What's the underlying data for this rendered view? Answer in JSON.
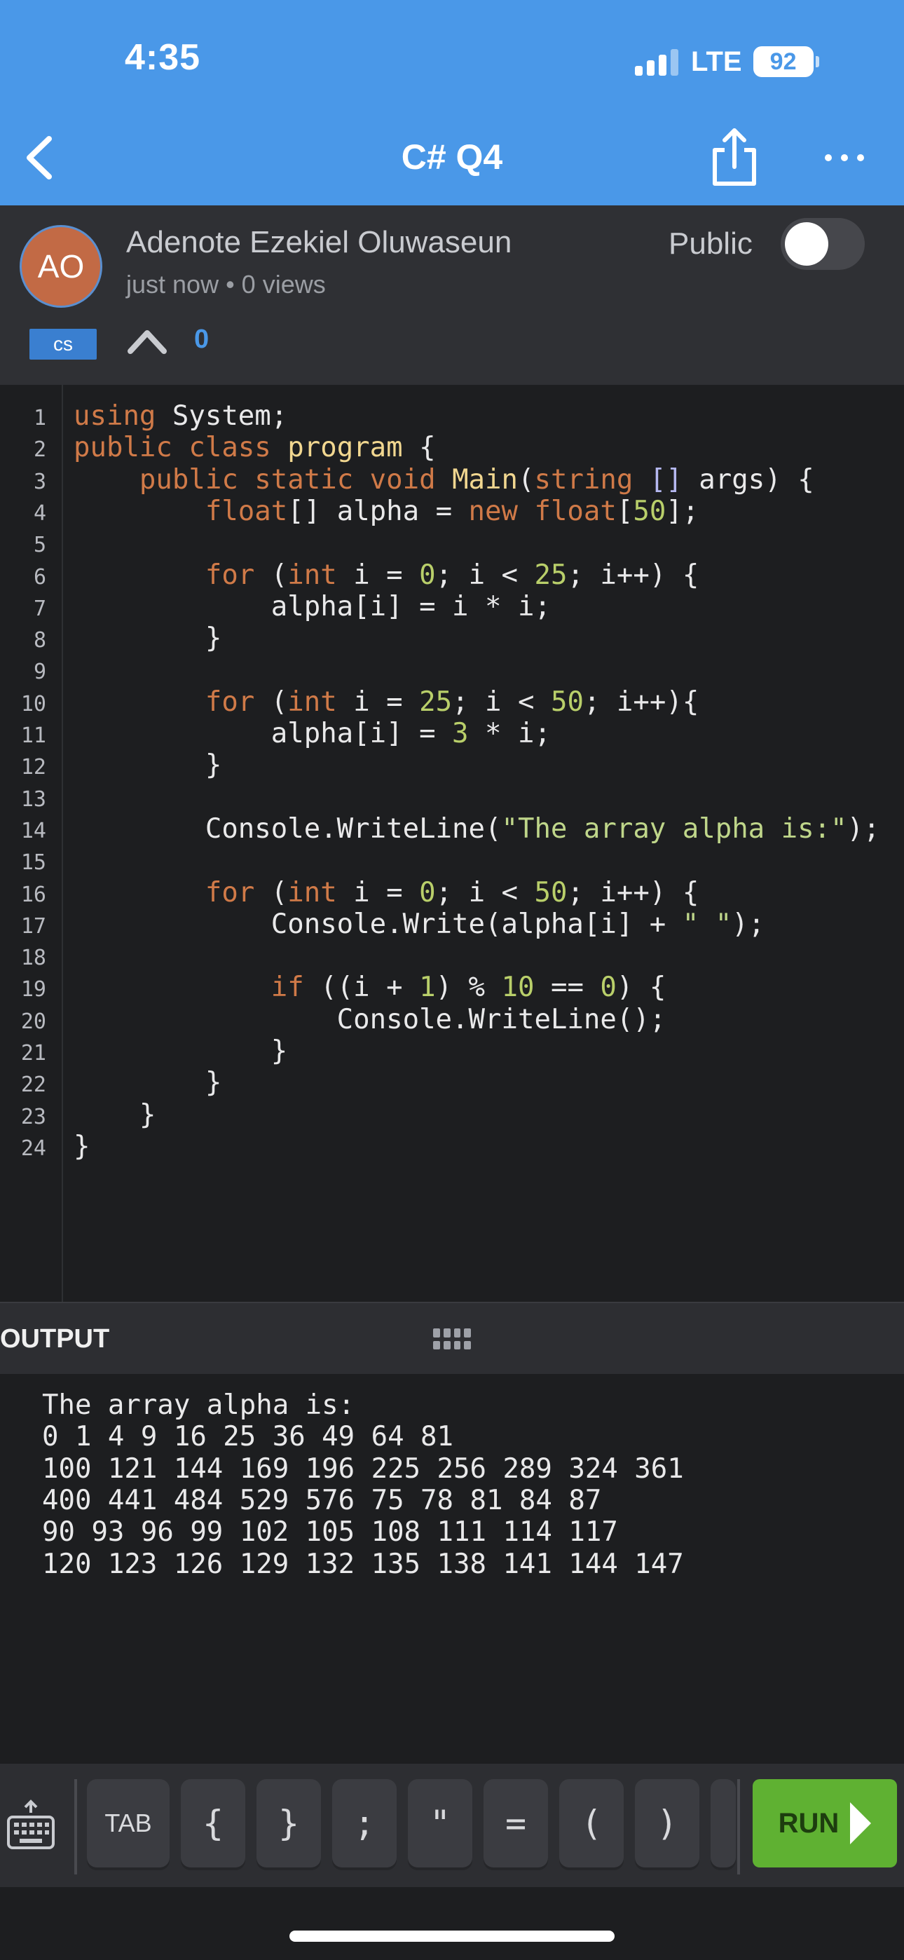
{
  "status_bar": {
    "time": "4:35",
    "network": "LTE",
    "battery": "92"
  },
  "nav": {
    "title": "C# Q4",
    "back_icon": "chevron-left-icon",
    "share_icon": "share-icon",
    "more_icon": "ellipsis-icon"
  },
  "post": {
    "avatar_initials": "AO",
    "author": "Adenote Ezekiel Oluwaseun",
    "meta": "just now • 0 views",
    "visibility_label": "Public",
    "public_toggle_on": false,
    "language": "cs",
    "votes": "0"
  },
  "code_lines": [
    {
      "n": "1",
      "t": "using System;"
    },
    {
      "n": "2",
      "t": "public class program {"
    },
    {
      "n": "3",
      "t": "    public static void Main(string [] args) {"
    },
    {
      "n": "4",
      "t": "        float[] alpha = new float[50];"
    },
    {
      "n": "5",
      "t": ""
    },
    {
      "n": "6",
      "t": "        for (int i = 0; i < 25; i++) {"
    },
    {
      "n": "7",
      "t": "            alpha[i] = i * i;"
    },
    {
      "n": "8",
      "t": "        }"
    },
    {
      "n": "9",
      "t": ""
    },
    {
      "n": "10",
      "t": "        for (int i = 25; i < 50; i++){"
    },
    {
      "n": "11",
      "t": "            alpha[i] = 3 * i;"
    },
    {
      "n": "12",
      "t": "        }"
    },
    {
      "n": "13",
      "t": ""
    },
    {
      "n": "14",
      "t": "        Console.WriteLine(\"The array alpha is:\");"
    },
    {
      "n": "15",
      "t": ""
    },
    {
      "n": "16",
      "t": "        for (int i = 0; i < 50; i++) {"
    },
    {
      "n": "17",
      "t": "            Console.Write(alpha[i] + \" \");"
    },
    {
      "n": "18",
      "t": ""
    },
    {
      "n": "19",
      "t": "            if ((i + 1) % 10 == 0) {"
    },
    {
      "n": "20",
      "t": "                Console.WriteLine();"
    },
    {
      "n": "21",
      "t": "            }"
    },
    {
      "n": "22",
      "t": "        }"
    },
    {
      "n": "23",
      "t": "    }"
    },
    {
      "n": "24",
      "t": "}"
    }
  ],
  "output": {
    "label": "OUTPUT",
    "lines": [
      "The array alpha is:",
      "0 1 4 9 16 25 36 49 64 81",
      "100 121 144 169 196 225 256 289 324 361",
      "400 441 484 529 576 75 78 81 84 87",
      "90 93 96 99 102 105 108 111 114 117",
      "120 123 126 129 132 135 138 141 144 147"
    ]
  },
  "toolbar": {
    "keyboard_icon": "keyboard-icon",
    "keys": [
      "TAB",
      "{",
      "}",
      ";",
      "\"",
      "=",
      "(",
      ")"
    ],
    "run_label": "RUN"
  }
}
